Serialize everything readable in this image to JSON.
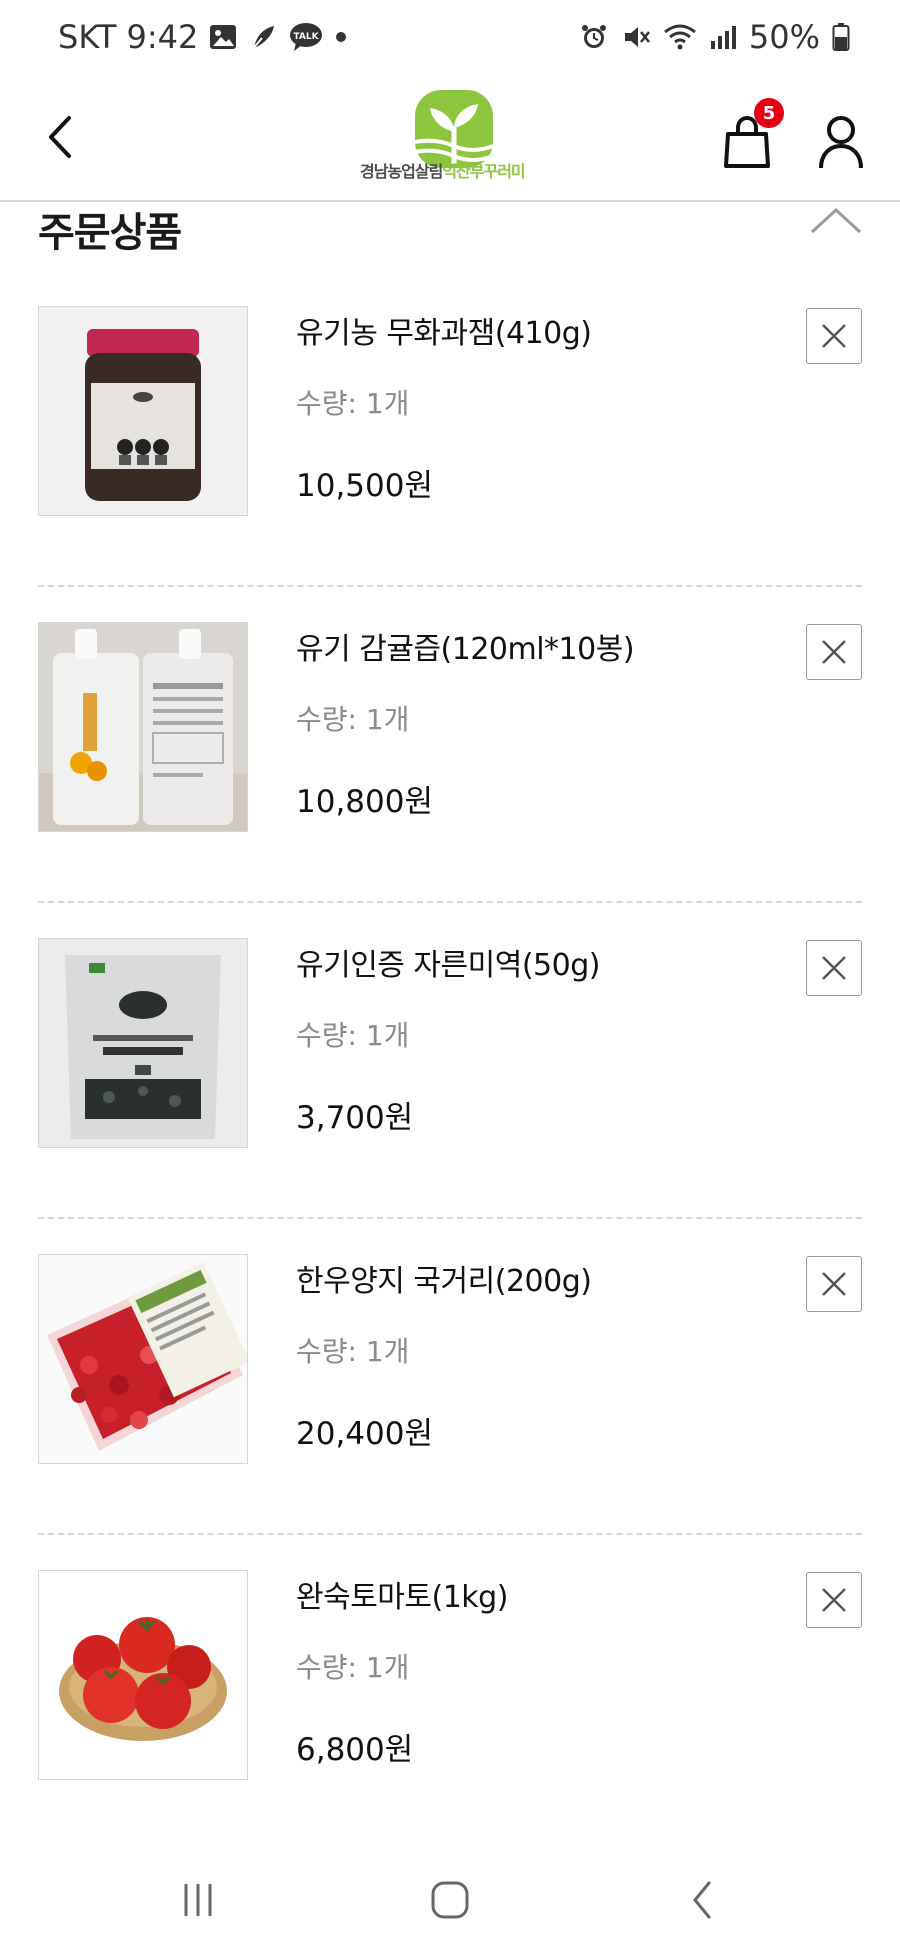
{
  "status_bar": {
    "carrier_time": "SKT 9:42",
    "battery": "50%",
    "talk_label": "TALK",
    "icons": [
      "gallery-icon",
      "feather-icon",
      "talk-icon",
      "dot-icon",
      "alarm-icon",
      "mute-icon",
      "wifi-icon",
      "signal-icon",
      "battery-icon"
    ]
  },
  "header": {
    "logo_text_a": "경남농업살림",
    "logo_text_b": "익산부꾸러미",
    "cart_count": "5",
    "icons": [
      "back-icon",
      "cart-icon",
      "user-icon"
    ]
  },
  "section": {
    "title": "주문상품",
    "collapse_icon": "chevron-up-icon"
  },
  "colors": {
    "badge": "#e60012",
    "logo_green": "#8cc63f",
    "divider": "#d8d8d8"
  },
  "items": [
    {
      "name": "유기농 무화과잼(410g)",
      "qty": "수량: 1개",
      "price": "10,500원",
      "image": "fig-jam-jar"
    },
    {
      "name": "유기 감귤즙(120ml*10봉)",
      "qty": "수량: 1개",
      "price": "10,800원",
      "image": "tangerine-juice-pouch"
    },
    {
      "name": "유기인증 자른미역(50g)",
      "qty": "수량: 1개",
      "price": "3,700원",
      "image": "seaweed-bag"
    },
    {
      "name": "한우양지 국거리(200g)",
      "qty": "수량: 1개",
      "price": "20,400원",
      "image": "beef-tray"
    },
    {
      "name": "완숙토마토(1kg)",
      "qty": "수량: 1개",
      "price": "6,800원",
      "image": "tomato-basket"
    }
  ],
  "nav": {
    "icons": [
      "recent-apps-icon",
      "home-icon",
      "nav-back-icon"
    ]
  }
}
